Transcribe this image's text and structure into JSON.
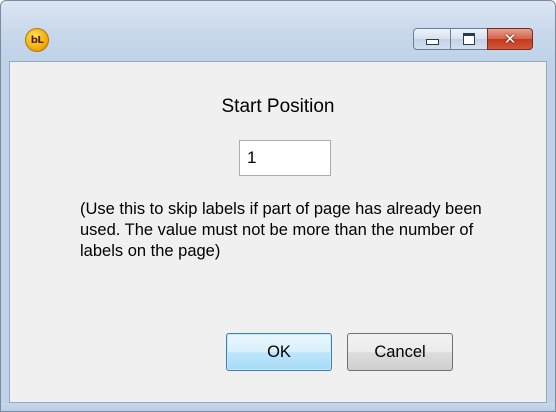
{
  "window": {
    "app_icon_text": "bL",
    "caption_buttons": [
      "minimize",
      "maximize",
      "close"
    ]
  },
  "dialog": {
    "title": "Start Position",
    "start_input_value": "1",
    "help_text": "(Use this to skip labels if part of page has already been used. The value must not be more than the number of labels on the page)",
    "ok_label": "OK",
    "cancel_label": "Cancel"
  },
  "colors": {
    "frame": "#c9d9ec",
    "client": "#f0f0f0",
    "close_button": "#c23a1d",
    "default_button_border": "#3c7fb1"
  }
}
